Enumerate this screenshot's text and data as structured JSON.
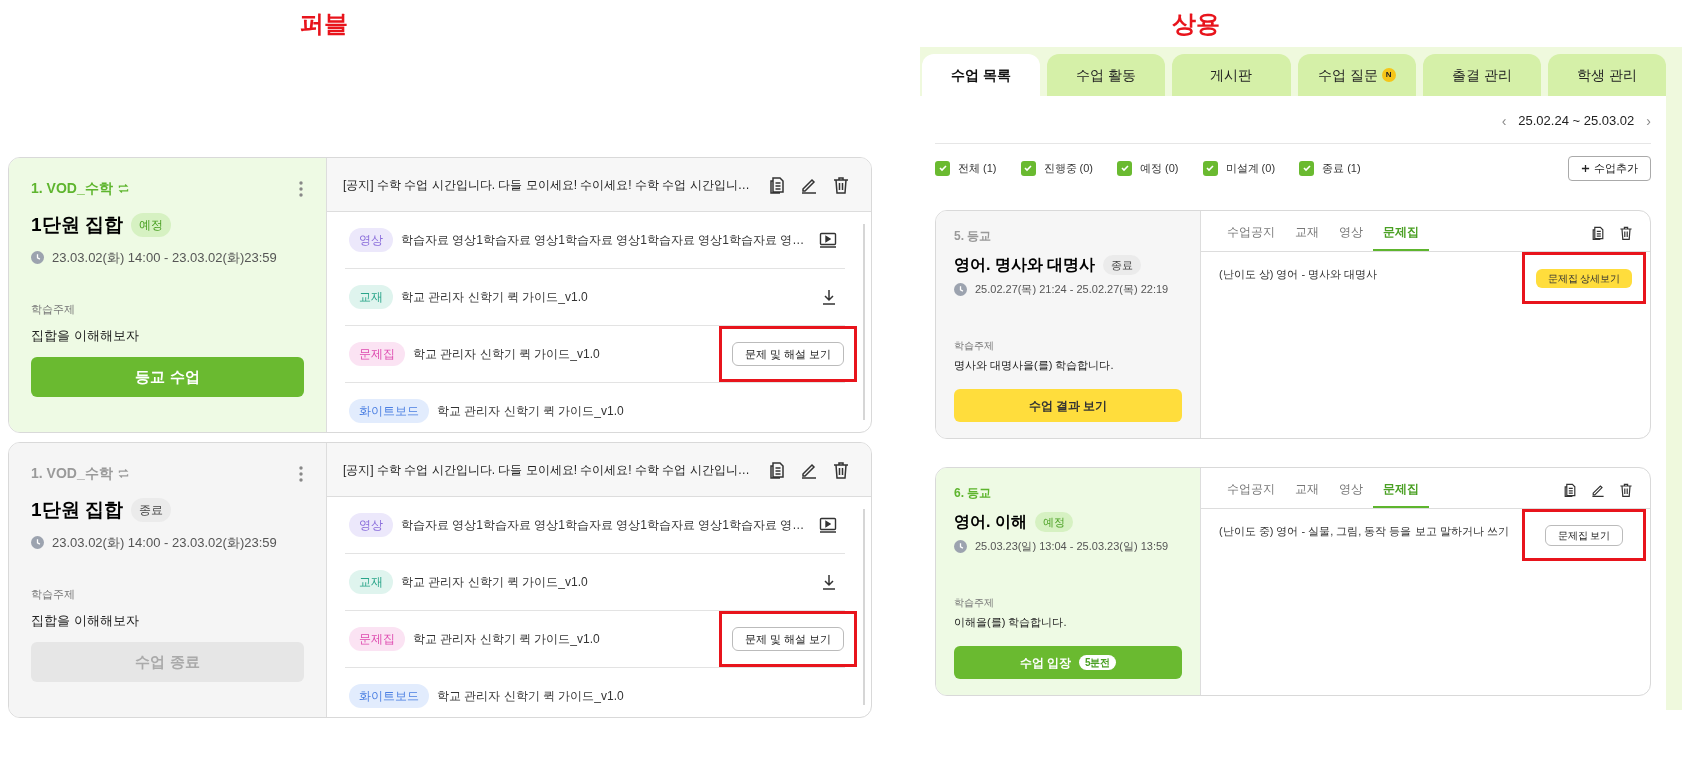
{
  "publ": {
    "title": "퍼블",
    "cards": [
      {
        "kind": "upcoming",
        "course": "1. VOD_수학",
        "title": "1단원 집합",
        "badge": "예정",
        "time": "23.03.02(화) 14:00 - 23.03.02(화)23:59",
        "topic_label": "학습주제",
        "topic": "집합을 이해해보자",
        "action": {
          "label": "등교 수업",
          "disabled": false
        },
        "notice": "[공지] 수학 수업 시간입니다. 다들 모이세요! 수이세요! 수학 수업 시간입니…",
        "materials": [
          {
            "kind": "video",
            "tag": "영상",
            "title": "학습자료 영상1학습자료 영상1학습자료 영상1학습자료 영상1학습자료 영…"
          },
          {
            "kind": "textbook",
            "tag": "교재",
            "title": "학교 관리자 신학기 퀵 가이드_v1.0"
          },
          {
            "kind": "workbook",
            "tag": "문제집",
            "title": "학교 관리자 신학기 퀵 가이드_v1.0",
            "button": {
              "label": "문제 및 해설 보기",
              "highlighted": true
            }
          },
          {
            "kind": "whiteboard",
            "tag": "화이트보드",
            "title": "학교 관리자 신학기 퀵 가이드_v1.0"
          }
        ]
      },
      {
        "kind": "ended",
        "course": "1. VOD_수학",
        "title": "1단원 집합",
        "badge": "종료",
        "time": "23.03.02(화) 14:00 - 23.03.02(화)23:59",
        "topic_label": "학습주제",
        "topic": "집합을 이해해보자",
        "action": {
          "label": "수업 종료",
          "disabled": true
        },
        "notice": "[공지] 수학 수업 시간입니다. 다들 모이세요! 수이세요! 수학 수업 시간입니…",
        "materials": [
          {
            "kind": "video",
            "tag": "영상",
            "title": "학습자료 영상1학습자료 영상1학습자료 영상1학습자료 영상1학습자료 영…"
          },
          {
            "kind": "textbook",
            "tag": "교재",
            "title": "학교 관리자 신학기 퀵 가이드_v1.0"
          },
          {
            "kind": "workbook",
            "tag": "문제집",
            "title": "학교 관리자 신학기 퀵 가이드_v1.0",
            "button": {
              "label": "문제 및 해설 보기",
              "highlighted": true
            }
          },
          {
            "kind": "whiteboard",
            "tag": "화이트보드",
            "title": "학교 관리자 신학기 퀵 가이드_v1.0"
          }
        ]
      }
    ]
  },
  "commercial": {
    "title": "상용",
    "tabs": [
      {
        "label": "수업 목록",
        "selected": true
      },
      {
        "label": "수업 활동",
        "selected": false
      },
      {
        "label": "게시판",
        "selected": false
      },
      {
        "label": "수업 질문",
        "selected": false,
        "badge": "N"
      },
      {
        "label": "출결 관리",
        "selected": false
      },
      {
        "label": "학생 관리",
        "selected": false
      }
    ],
    "date_prev": "‹",
    "date_range": "25.02.24 ~ 25.03.02",
    "date_next": "›",
    "filters": [
      {
        "label": "전체",
        "count": "(1)",
        "checked": true
      },
      {
        "label": "진행중",
        "count": "(0)",
        "checked": true
      },
      {
        "label": "예정",
        "count": "(0)",
        "checked": true
      },
      {
        "label": "미설계",
        "count": "(0)",
        "checked": true
      },
      {
        "label": "종료",
        "count": "(1)",
        "checked": true
      }
    ],
    "add_button": "수업추가",
    "cards": [
      {
        "kind": "ended",
        "course": "5. 등교",
        "title": "영어. 명사와 대명사",
        "badge": "종료",
        "time": "25.02.27(목) 21:24 - 25.02.27(목) 22:19",
        "topic_label": "학습주제",
        "topic": "명사와 대명사을(를) 학습합니다.",
        "action": {
          "kind": "result",
          "label": "수업 결과 보기"
        },
        "editable": false,
        "tabs": [
          {
            "label": "수업공지",
            "selected": false
          },
          {
            "label": "교재",
            "selected": false
          },
          {
            "label": "영상",
            "selected": false
          },
          {
            "label": "문제집",
            "selected": true
          }
        ],
        "item": "(난이도 상) 영어 - 명사와 대명사",
        "button": {
          "kind": "primary",
          "label": "문제집 상세보기",
          "highlighted": true
        }
      },
      {
        "kind": "upcoming",
        "course": "6. 등교",
        "title": "영어. 이해",
        "badge": "예정",
        "time": "25.03.23(일) 13:04 - 25.03.23(일) 13:59",
        "topic_label": "학습주제",
        "topic": "이해을(를) 학습합니다.",
        "action": {
          "kind": "enter",
          "label": "수업 입장",
          "badge": "5분전"
        },
        "editable": true,
        "tabs": [
          {
            "label": "수업공지",
            "selected": false
          },
          {
            "label": "교재",
            "selected": false
          },
          {
            "label": "영상",
            "selected": false
          },
          {
            "label": "문제집",
            "selected": true
          }
        ],
        "item": "(난이도 중) 영어 - 실물, 그림, 동작 등을 보고 말하거나 쓰기",
        "button": {
          "kind": "outline",
          "label": "문제집 보기",
          "highlighted": true
        }
      }
    ]
  }
}
